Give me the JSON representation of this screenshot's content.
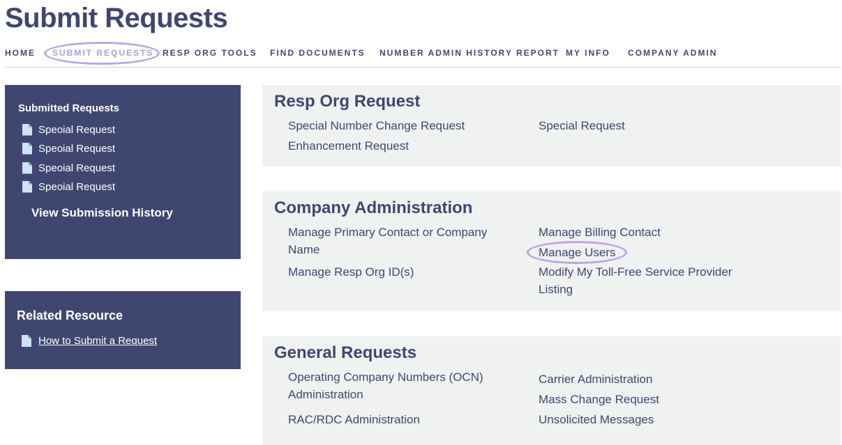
{
  "page": {
    "title": "Submit Requests"
  },
  "nav": {
    "items": [
      {
        "label": "HOME"
      },
      {
        "label": "SUBMIT REQUESTS"
      },
      {
        "label": "RESP ORG TOOLS"
      },
      {
        "label": "FIND DOCUMENTS"
      },
      {
        "label": "NUMBER ADMIN HISTORY REPORT"
      },
      {
        "label": "MY INFO"
      },
      {
        "label": "COMPANY ADMIN"
      }
    ]
  },
  "submitted": {
    "heading": "Submitted Requests",
    "items": [
      {
        "label": "Speoial Request"
      },
      {
        "label": "Speoial Request"
      },
      {
        "label": "Speoial Request"
      },
      {
        "label": "Speoial Request"
      }
    ],
    "history_label": "View Submission History"
  },
  "related": {
    "heading": "Related Resource",
    "link_label": "How to Submit a Request"
  },
  "resp_org": {
    "title": "Resp Org Request",
    "links": {
      "special_number_change": "Special Number Change Request",
      "enhancement": "Enhancement Request",
      "special_request": "Special Request"
    }
  },
  "company_admin": {
    "title": "Company Administration",
    "links": {
      "primary_contact": "Manage Primary Contact or Company Name",
      "resp_org_id": "Manage Resp Org ID(s)",
      "billing_contact": "Manage Billing Contact",
      "manage_users": "Manage Users",
      "toll_free_listing": "Modify My Toll-Free Service Provider Listing"
    }
  },
  "general": {
    "title": "General Requests",
    "links": {
      "ocn": "Operating Company Numbers (OCN) Administration",
      "rac_rdc": "RAC/RDC Administration",
      "carrier_admin": "Carrier Administration",
      "mass_change": "Mass Change Request",
      "unsolicited": "Unsolicited Messages"
    }
  }
}
